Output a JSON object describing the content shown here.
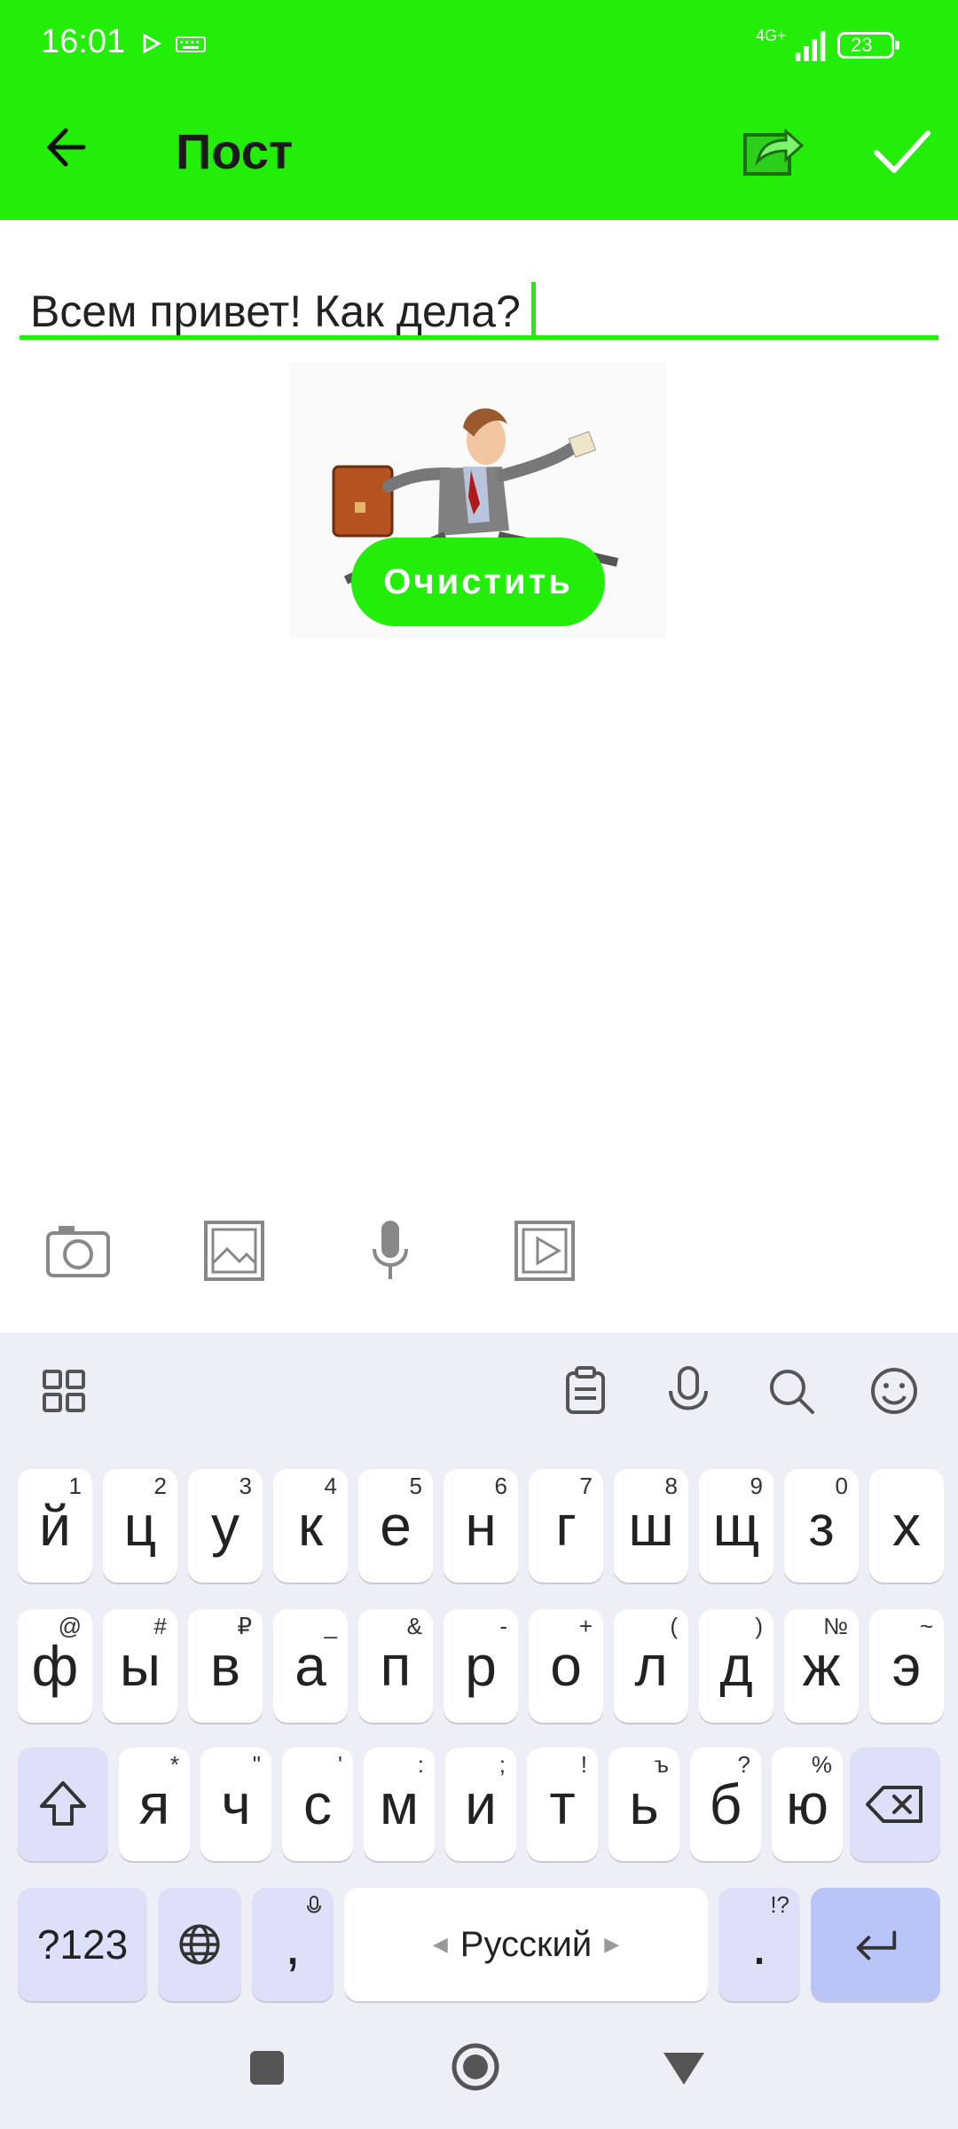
{
  "status_bar": {
    "time": "16:01",
    "network": "4G+",
    "battery": "23"
  },
  "app_bar": {
    "title": "Пост"
  },
  "editor": {
    "text": "Всем привет! Как дела?"
  },
  "image": {
    "clear_label": "Очистить"
  },
  "keyboard": {
    "rows": [
      [
        {
          "k": "й",
          "h": "1"
        },
        {
          "k": "ц",
          "h": "2"
        },
        {
          "k": "у",
          "h": "3"
        },
        {
          "k": "к",
          "h": "4"
        },
        {
          "k": "е",
          "h": "5"
        },
        {
          "k": "н",
          "h": "6"
        },
        {
          "k": "г",
          "h": "7"
        },
        {
          "k": "ш",
          "h": "8"
        },
        {
          "k": "щ",
          "h": "9"
        },
        {
          "k": "з",
          "h": "0"
        },
        {
          "k": "х",
          "h": ""
        }
      ],
      [
        {
          "k": "ф",
          "h": "@"
        },
        {
          "k": "ы",
          "h": "#"
        },
        {
          "k": "в",
          "h": "₽"
        },
        {
          "k": "а",
          "h": "_"
        },
        {
          "k": "п",
          "h": "&"
        },
        {
          "k": "р",
          "h": "-"
        },
        {
          "k": "о",
          "h": "+"
        },
        {
          "k": "л",
          "h": "("
        },
        {
          "k": "д",
          "h": ")"
        },
        {
          "k": "ж",
          "h": "№"
        },
        {
          "k": "э",
          "h": "~"
        }
      ],
      [
        {
          "k": "я",
          "h": "*"
        },
        {
          "k": "ч",
          "h": "\""
        },
        {
          "k": "с",
          "h": "'"
        },
        {
          "k": "м",
          "h": ":"
        },
        {
          "k": "и",
          "h": ";"
        },
        {
          "k": "т",
          "h": "!"
        },
        {
          "k": "ь",
          "h": "ъ"
        },
        {
          "k": "б",
          "h": "?"
        },
        {
          "k": "ю",
          "h": "%"
        }
      ]
    ],
    "symbols_label": "?123",
    "comma_label": ",",
    "space_label": "Русский",
    "period_label": ".",
    "period_hint": "!?"
  }
}
